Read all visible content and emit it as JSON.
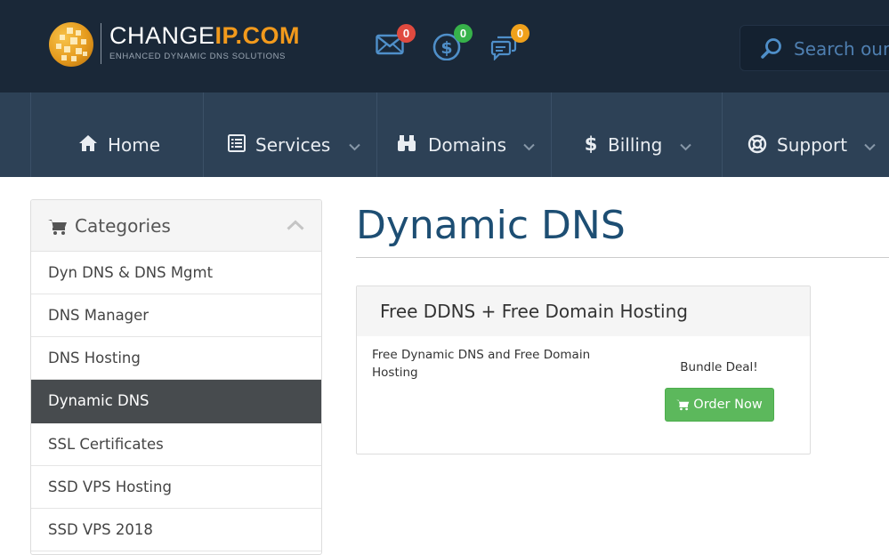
{
  "brand": {
    "logo_prefix": "CHANGE",
    "logo_suffix": "IP.COM",
    "tagline": "ENHANCED DYNAMIC DNS SOLUTIONS",
    "accent_color": "#f29a1c"
  },
  "header": {
    "notifications": [
      {
        "icon": "mail-icon",
        "count": "0",
        "color": "#e04a3f"
      },
      {
        "icon": "dollar-circle-icon",
        "count": "0",
        "color": "#37b24a"
      },
      {
        "icon": "chat-icon",
        "count": "0",
        "color": "#f0a11b"
      }
    ],
    "search_placeholder": "Search our knowledgebase..."
  },
  "nav": {
    "items": [
      {
        "label": "Home",
        "icon": "home-icon"
      },
      {
        "label": "Services",
        "icon": "list-icon"
      },
      {
        "label": "Domains",
        "icon": "binoculars-icon"
      },
      {
        "label": "Billing",
        "icon": "dollar-icon"
      },
      {
        "label": "Support",
        "icon": "lifebuoy-icon"
      }
    ]
  },
  "sidebar": {
    "title": "Categories",
    "items": [
      {
        "label": "Dyn DNS & DNS Mgmt"
      },
      {
        "label": "DNS Manager"
      },
      {
        "label": "DNS Hosting"
      },
      {
        "label": "Dynamic DNS",
        "active": true
      },
      {
        "label": "SSL Certificates"
      },
      {
        "label": "SSD VPS Hosting"
      },
      {
        "label": "SSD VPS 2018"
      }
    ]
  },
  "main": {
    "page_title": "Dynamic DNS",
    "product": {
      "name": "Free DDNS + Free Domain Hosting",
      "description": "Free Dynamic DNS and Free Domain Hosting",
      "price_label": "Bundle Deal!",
      "order_label": "Order Now"
    }
  }
}
